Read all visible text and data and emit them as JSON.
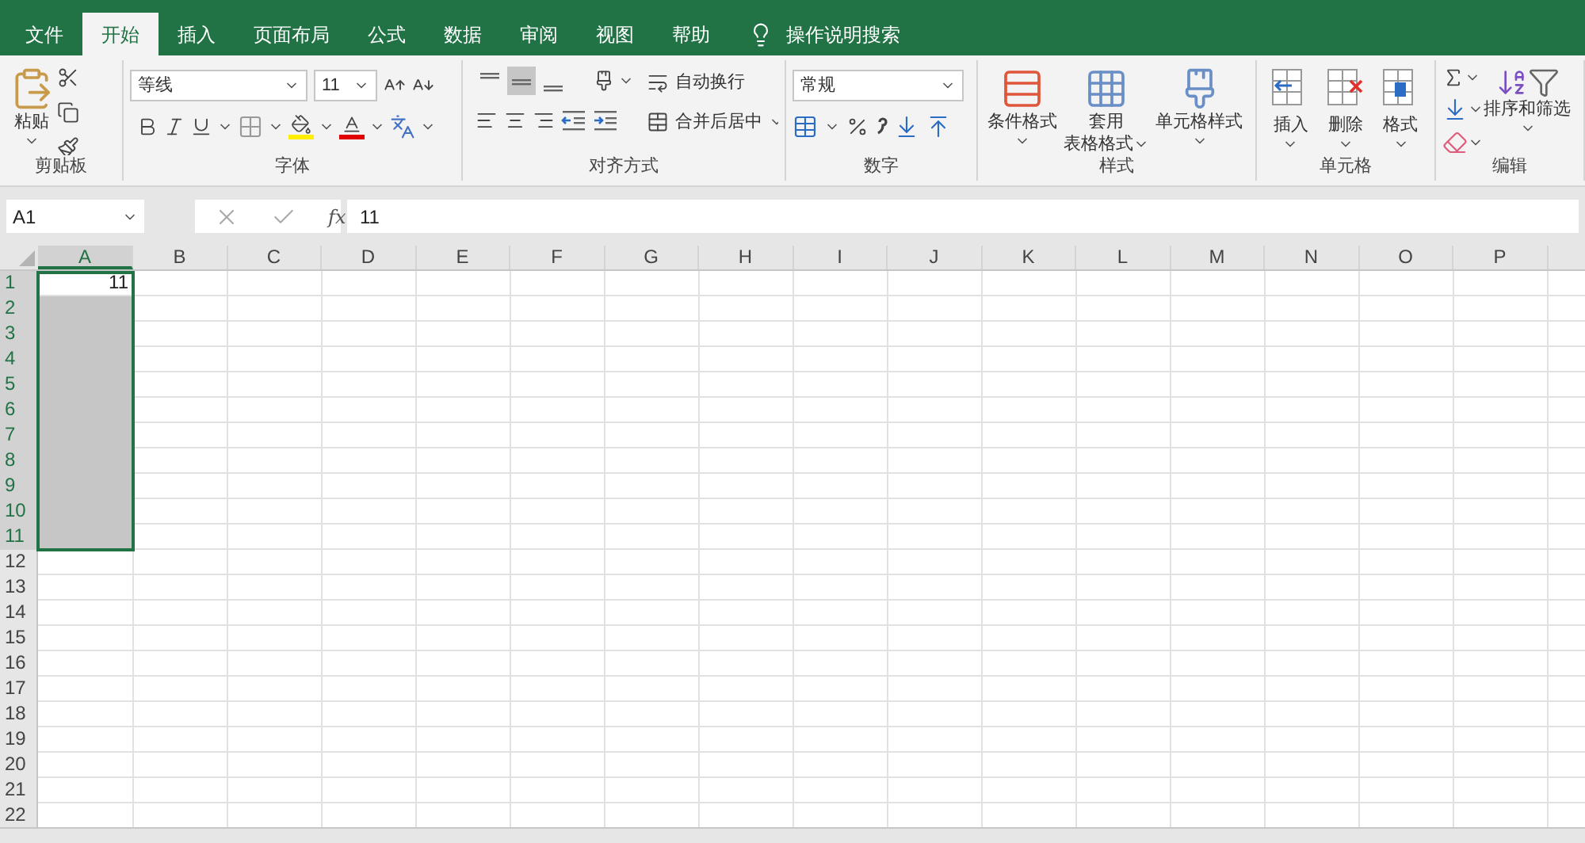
{
  "ribbon_tabs": [
    {
      "label": "文件",
      "selected": false
    },
    {
      "label": "开始",
      "selected": true
    },
    {
      "label": "插入",
      "selected": false
    },
    {
      "label": "页面布局",
      "selected": false
    },
    {
      "label": "公式",
      "selected": false
    },
    {
      "label": "数据",
      "selected": false
    },
    {
      "label": "审阅",
      "selected": false
    },
    {
      "label": "视图",
      "selected": false
    },
    {
      "label": "帮助",
      "selected": false
    }
  ],
  "tell_me": "操作说明搜索",
  "ribbon": {
    "clipboard": {
      "paste": "粘贴",
      "label": "剪贴板"
    },
    "font": {
      "name": "等线",
      "size": "11",
      "label": "字体"
    },
    "alignment": {
      "wrap": "自动换行",
      "merge": "合并后居中",
      "label": "对齐方式",
      "vertical_align_buttons": [
        {
          "selected": false
        },
        {
          "selected": true
        },
        {
          "selected": false
        }
      ]
    },
    "number": {
      "format": "常规",
      "label": "数字"
    },
    "styles": {
      "conditional": "条件格式",
      "table_lines": [
        "套用",
        "表格格式"
      ],
      "cell_styles": "单元格样式",
      "label": "样式"
    },
    "cells": {
      "insert": "插入",
      "delete": "删除",
      "format": "格式",
      "label": "单元格"
    },
    "editing": {
      "sort_filter": "排序和筛选",
      "label": "编辑"
    }
  },
  "name_box": "A1",
  "function_label": "fx",
  "formula": "11",
  "columns": [
    {
      "label": "A",
      "selected": true
    },
    {
      "label": "B",
      "selected": false
    },
    {
      "label": "C",
      "selected": false
    },
    {
      "label": "D",
      "selected": false
    },
    {
      "label": "E",
      "selected": false
    },
    {
      "label": "F",
      "selected": false
    },
    {
      "label": "G",
      "selected": false
    },
    {
      "label": "H",
      "selected": false
    },
    {
      "label": "I",
      "selected": false
    },
    {
      "label": "J",
      "selected": false
    },
    {
      "label": "K",
      "selected": false
    },
    {
      "label": "L",
      "selected": false
    },
    {
      "label": "M",
      "selected": false
    },
    {
      "label": "N",
      "selected": false
    },
    {
      "label": "O",
      "selected": false
    },
    {
      "label": "P",
      "selected": false
    }
  ],
  "rows": [
    {
      "label": "1",
      "selected": true,
      "cells": [
        "11"
      ]
    },
    {
      "label": "2",
      "selected": true
    },
    {
      "label": "3",
      "selected": true
    },
    {
      "label": "4",
      "selected": true
    },
    {
      "label": "5",
      "selected": true
    },
    {
      "label": "6",
      "selected": true
    },
    {
      "label": "7",
      "selected": true
    },
    {
      "label": "8",
      "selected": true
    },
    {
      "label": "9",
      "selected": true
    },
    {
      "label": "10",
      "selected": true
    },
    {
      "label": "11",
      "selected": true
    },
    {
      "label": "12",
      "selected": false
    },
    {
      "label": "13",
      "selected": false
    },
    {
      "label": "14",
      "selected": false
    },
    {
      "label": "15",
      "selected": false
    },
    {
      "label": "16",
      "selected": false
    },
    {
      "label": "17",
      "selected": false
    },
    {
      "label": "18",
      "selected": false
    },
    {
      "label": "19",
      "selected": false
    },
    {
      "label": "20",
      "selected": false
    },
    {
      "label": "21",
      "selected": false
    },
    {
      "label": "22",
      "selected": false
    }
  ]
}
